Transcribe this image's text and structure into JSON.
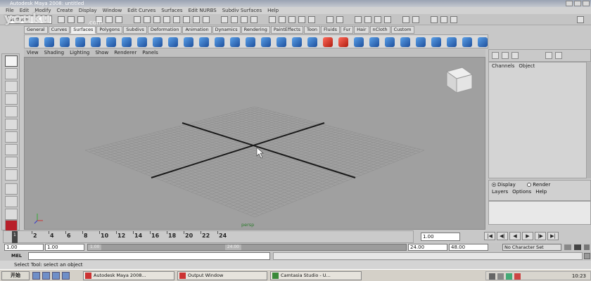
{
  "window": {
    "title": "Autodesk Maya 2008: untitled"
  },
  "menubar": {
    "items": [
      "File",
      "Edit",
      "Modify",
      "Create",
      "Display",
      "Window",
      "Edit Curves",
      "Surfaces",
      "Edit NURBS",
      "Subdiv Surfaces",
      "Help"
    ]
  },
  "statusline": {
    "mode": "Surfaces"
  },
  "shelf": {
    "tabs": [
      "General",
      "Curves",
      "Surfaces",
      "Polygons",
      "Subdivs",
      "Deformation",
      "Animation",
      "Dynamics",
      "Rendering",
      "PaintEffects",
      "Toon",
      "Fluids",
      "Fur",
      "Hair",
      "nCloth",
      "Custom"
    ],
    "active_tab": "Surfaces"
  },
  "panel": {
    "menu": [
      "View",
      "Shading",
      "Lighting",
      "Show",
      "Renderer",
      "Panels"
    ],
    "camera_label": "persp"
  },
  "channelbox": {
    "menu": [
      "Channels",
      "Object"
    ]
  },
  "layers": {
    "display_label": "Display",
    "render_label": "Render",
    "menu": [
      "Layers",
      "Options",
      "Help"
    ]
  },
  "timeslider": {
    "ticks": [
      "2",
      "4",
      "6",
      "8",
      "10",
      "12",
      "14",
      "16",
      "18",
      "20",
      "22",
      "24"
    ],
    "current_frame_marker": "1",
    "current_frame": "1.00"
  },
  "rangeslider": {
    "start": "1.00",
    "current_start": "1.00",
    "handle_start": "1.00",
    "handle_end": "24.00",
    "end": "24.00",
    "total_end": "48.00",
    "character_set": "No Character Set"
  },
  "commandline": {
    "label": "MEL"
  },
  "helpline": {
    "text": "Select Tool: select an object"
  },
  "taskbar": {
    "start": "开始",
    "tasks": [
      "Autodesk Maya 2008...",
      "Output Window",
      "Camtasia Studio - U..."
    ],
    "clock": "10:23"
  },
  "watermark": {
    "text": "youku",
    "sub": ".com"
  },
  "colors": {
    "viewport_bg": "#a0a0a0",
    "grid_line": "#8c8c8c",
    "axis_line": "#1a1a1a",
    "persp_label": "#2a7a2a"
  }
}
